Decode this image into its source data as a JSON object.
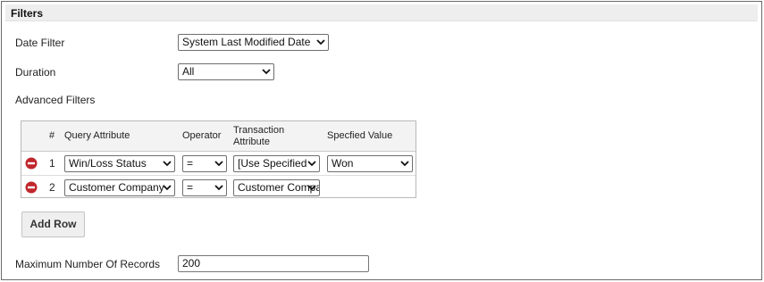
{
  "panel": {
    "title": "Filters"
  },
  "date_filter": {
    "label": "Date Filter",
    "value": "System Last Modified Date"
  },
  "duration": {
    "label": "Duration",
    "value": "All"
  },
  "advanced_filters": {
    "label": "Advanced Filters",
    "columns": {
      "index": "#",
      "query_attribute": "Query Attribute",
      "operator": "Operator",
      "transaction_attribute_line1": "Transaction",
      "transaction_attribute_line2": "Attribute",
      "specified_value": "Specfied Value"
    },
    "rows": [
      {
        "num": "1",
        "query_attribute": "Win/Loss Status",
        "operator": "=",
        "transaction_attribute": "[Use Specified",
        "specified_value": "Won"
      },
      {
        "num": "2",
        "query_attribute": "Customer Company",
        "operator": "=",
        "transaction_attribute": "Customer Company",
        "specified_value": ""
      }
    ],
    "add_row_label": "Add Row"
  },
  "max_records": {
    "label": "Maximum Number Of Records",
    "value": "200"
  },
  "colors": {
    "remove_icon": "#c0272d",
    "header_bg": "#eeeeee",
    "grid_header_bg": "#f3f3f3"
  },
  "icons": {
    "remove": "remove-circle-icon",
    "dropdown": "chevron-down-icon"
  }
}
